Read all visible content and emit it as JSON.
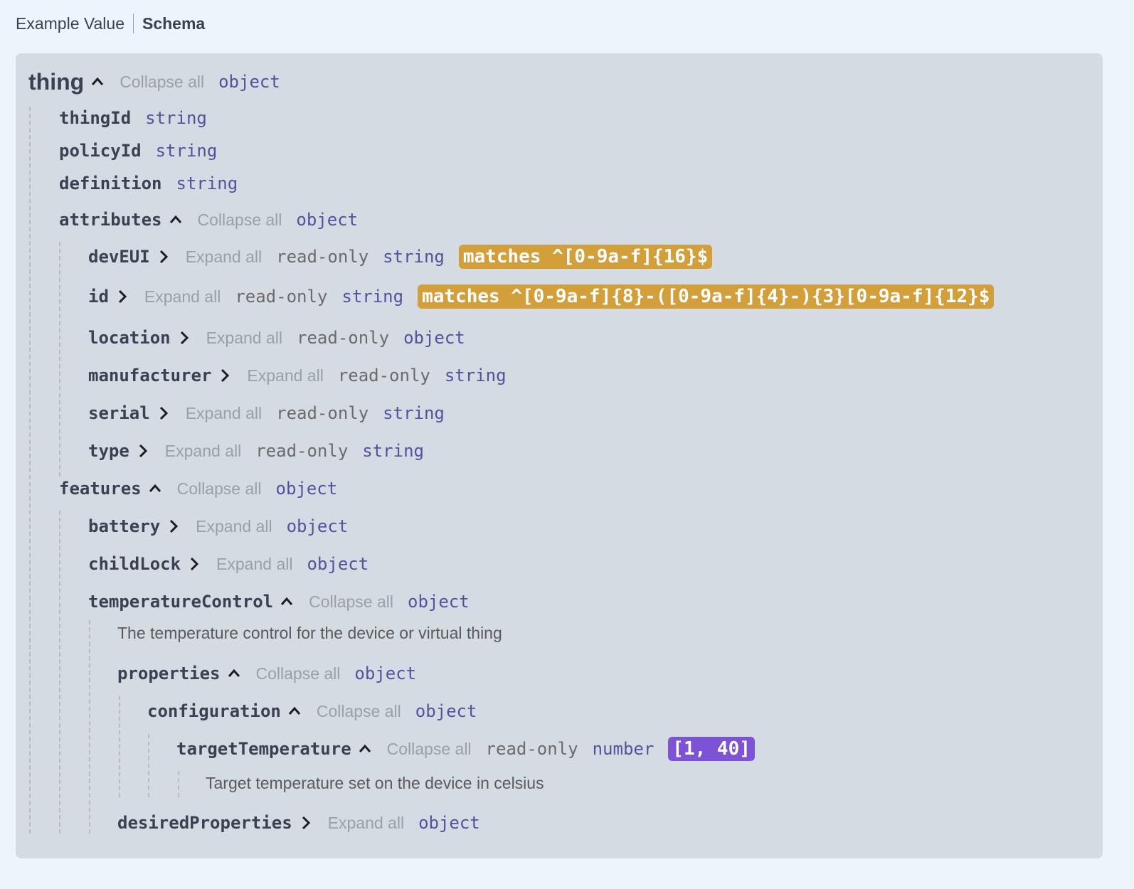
{
  "tabs": {
    "example": "Example Value",
    "schema": "Schema"
  },
  "labels": {
    "collapse_all": "Collapse all",
    "expand_all": "Expand all",
    "read_only": "read-only"
  },
  "colors": {
    "pattern_badge": "#d39f3b",
    "range_badge": "#7d52d5",
    "type_text": "#55529c"
  },
  "schema": {
    "root": {
      "name": "thing",
      "type": "object"
    },
    "thingId": {
      "name": "thingId",
      "type": "string"
    },
    "policyId": {
      "name": "policyId",
      "type": "string"
    },
    "definition": {
      "name": "definition",
      "type": "string"
    },
    "attributes": {
      "name": "attributes",
      "type": "object"
    },
    "devEUI": {
      "name": "devEUI",
      "type": "string",
      "pattern": "matches ^[0-9a-f]{16}$"
    },
    "id": {
      "name": "id",
      "type": "string",
      "pattern": "matches ^[0-9a-f]{8}-([0-9a-f]{4}-){3}[0-9a-f]{12}$"
    },
    "location": {
      "name": "location",
      "type": "object"
    },
    "manufacturer": {
      "name": "manufacturer",
      "type": "string"
    },
    "serial": {
      "name": "serial",
      "type": "string"
    },
    "type_field": {
      "name": "type",
      "type": "string"
    },
    "features": {
      "name": "features",
      "type": "object"
    },
    "battery": {
      "name": "battery",
      "type": "object"
    },
    "childLock": {
      "name": "childLock",
      "type": "object"
    },
    "temperatureControl": {
      "name": "temperatureControl",
      "type": "object",
      "description": "The temperature control for the device or virtual thing"
    },
    "properties": {
      "name": "properties",
      "type": "object"
    },
    "configuration": {
      "name": "configuration",
      "type": "object"
    },
    "targetTemperature": {
      "name": "targetTemperature",
      "type": "number",
      "range": "[1, 40]",
      "description": "Target temperature set on the device in celsius"
    },
    "desiredProperties": {
      "name": "desiredProperties",
      "type": "object"
    }
  }
}
